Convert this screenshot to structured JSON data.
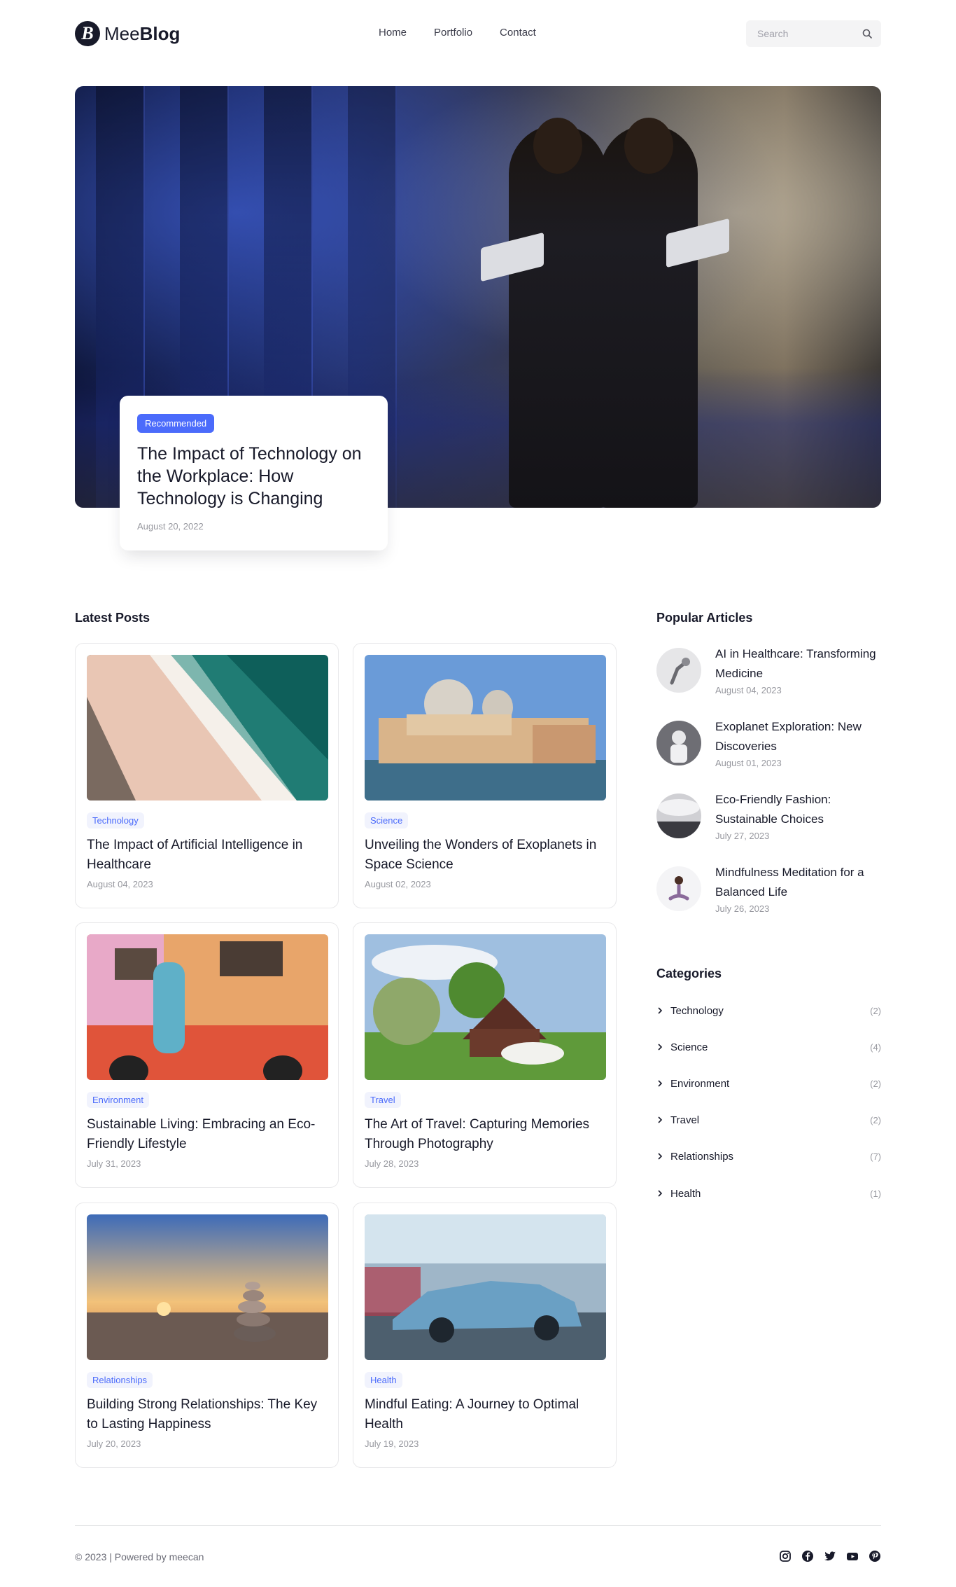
{
  "header": {
    "logo_prefix": "Mee",
    "logo_bold": "Blog",
    "nav": [
      "Home",
      "Portfolio",
      "Contact"
    ],
    "search_placeholder": "Search"
  },
  "hero": {
    "badge": "Recommended",
    "title": "The Impact of Technology on the Workplace: How Technology is Changing",
    "date": "August 20, 2022"
  },
  "latest": {
    "heading": "Latest Posts",
    "posts": [
      {
        "tag": "Technology",
        "title": "The Impact of Artificial Intelligence in Healthcare",
        "date": "August 04, 2023"
      },
      {
        "tag": "Science",
        "title": "Unveiling the Wonders of Exoplanets in Space Science",
        "date": "August 02, 2023"
      },
      {
        "tag": "Environment",
        "title": "Sustainable Living: Embracing an Eco-Friendly Lifestyle",
        "date": "July 31, 2023"
      },
      {
        "tag": "Travel",
        "title": "The Art of Travel: Capturing Memories Through Photography",
        "date": "July 28, 2023"
      },
      {
        "tag": "Relationships",
        "title": "Building Strong Relationships: The Key to Lasting Happiness",
        "date": "July 20, 2023"
      },
      {
        "tag": "Health",
        "title": "Mindful Eating: A Journey to Optimal Health",
        "date": "July 19, 2023"
      }
    ]
  },
  "popular": {
    "heading": "Popular Articles",
    "items": [
      {
        "title": "AI in Healthcare: Transforming Medicine",
        "date": "August 04, 2023"
      },
      {
        "title": "Exoplanet Exploration: New Discoveries",
        "date": "August 01, 2023"
      },
      {
        "title": "Eco-Friendly Fashion: Sustainable Choices",
        "date": "July 27, 2023"
      },
      {
        "title": "Mindfulness Meditation for a Balanced Life",
        "date": "July 26, 2023"
      }
    ]
  },
  "categories": {
    "heading": "Categories",
    "items": [
      {
        "name": "Technology",
        "count": "(2)"
      },
      {
        "name": "Science",
        "count": "(4)"
      },
      {
        "name": "Environment",
        "count": "(2)"
      },
      {
        "name": "Travel",
        "count": "(2)"
      },
      {
        "name": "Relationships",
        "count": "(7)"
      },
      {
        "name": "Health",
        "count": "(1)"
      }
    ]
  },
  "footer": {
    "copyright": "© 2023 | Powered by meecan",
    "social_icons": [
      "instagram-icon",
      "facebook-icon",
      "twitter-icon",
      "youtube-icon",
      "pinterest-icon"
    ]
  },
  "colors": {
    "accent": "#4b6bfb",
    "text": "#181a2a",
    "muted": "#97989f"
  }
}
